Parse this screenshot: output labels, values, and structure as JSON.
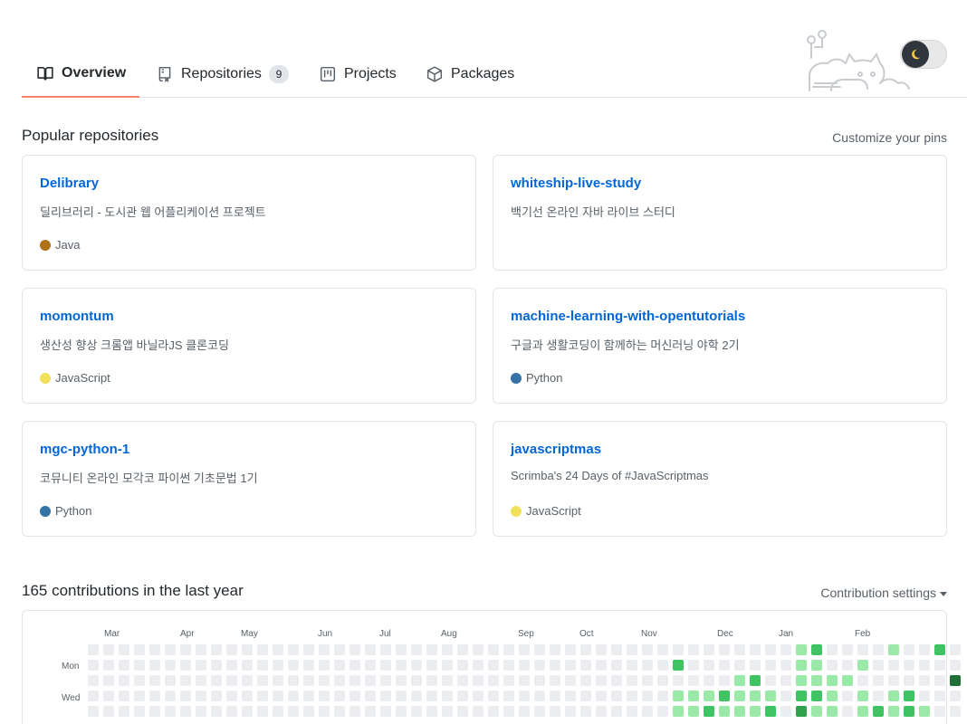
{
  "tabs": [
    {
      "label": "Overview",
      "icon": "book-icon",
      "active": true
    },
    {
      "label": "Repositories",
      "icon": "repo-icon",
      "count": "9"
    },
    {
      "label": "Projects",
      "icon": "project-icon"
    },
    {
      "label": "Packages",
      "icon": "package-icon"
    }
  ],
  "theme_toggle": {
    "icon": "moon-icon",
    "knob_color": "#2f363d"
  },
  "popular": {
    "title": "Popular repositories",
    "customize_link": "Customize your pins",
    "repos": [
      {
        "name": "Delibrary",
        "description": "딜리브러리 - 도시관 웹 어플리케이션 프로젝트",
        "language": "Java",
        "color": "#b07219"
      },
      {
        "name": "whiteship-live-study",
        "description": "백기선 온라인 자바 라이브 스터디",
        "language": "",
        "color": ""
      },
      {
        "name": "momontum",
        "description": "생산성 향상 크롬앱 바닐라JS 클론코딩",
        "language": "JavaScript",
        "color": "#f1e05a"
      },
      {
        "name": "machine-learning-with-opentutorials",
        "description": "구글과 생활코딩이 함께하는 머신러닝 야학 2기",
        "language": "Python",
        "color": "#3572A5"
      },
      {
        "name": "mgc-python-1",
        "description": "코뮤니티 온라인 모각코 파이썬 기초문법 1기",
        "language": "Python",
        "color": "#3572A5"
      },
      {
        "name": "javascriptmas",
        "description": "Scrimba's 24 Days of #JavaScriptmas",
        "language": "JavaScript",
        "color": "#f1e05a"
      }
    ]
  },
  "contributions": {
    "title": "165 contributions in the last year",
    "settings_label": "Contribution settings",
    "months": [
      "Mar",
      "Apr",
      "May",
      "Jun",
      "Jul",
      "Aug",
      "Sep",
      "Oct",
      "Nov",
      "Dec",
      "Jan",
      "Feb"
    ],
    "weekdays": [
      "Mon",
      "Wed"
    ],
    "level_colors": [
      "#ebedf0",
      "#9be9a8",
      "#40c463",
      "#30a14e",
      "#216e39"
    ],
    "weeks": [
      [
        0,
        0,
        0,
        0,
        0
      ],
      [
        0,
        0,
        0,
        0,
        0
      ],
      [
        0,
        0,
        0,
        0,
        0
      ],
      [
        0,
        0,
        0,
        0,
        0
      ],
      [
        0,
        0,
        0,
        0,
        0
      ],
      [
        0,
        0,
        0,
        0,
        0
      ],
      [
        0,
        0,
        0,
        0,
        0
      ],
      [
        0,
        0,
        0,
        0,
        0
      ],
      [
        0,
        0,
        0,
        0,
        0
      ],
      [
        0,
        0,
        0,
        0,
        0
      ],
      [
        0,
        0,
        0,
        0,
        0
      ],
      [
        0,
        0,
        0,
        0,
        0
      ],
      [
        0,
        0,
        0,
        0,
        0
      ],
      [
        0,
        0,
        0,
        0,
        0
      ],
      [
        0,
        0,
        0,
        0,
        0
      ],
      [
        0,
        0,
        0,
        0,
        0
      ],
      [
        0,
        0,
        0,
        0,
        0
      ],
      [
        0,
        0,
        0,
        0,
        0
      ],
      [
        0,
        0,
        0,
        0,
        0
      ],
      [
        0,
        0,
        0,
        0,
        0
      ],
      [
        0,
        0,
        0,
        0,
        0
      ],
      [
        0,
        0,
        0,
        0,
        0
      ],
      [
        0,
        0,
        0,
        0,
        0
      ],
      [
        0,
        0,
        0,
        0,
        0
      ],
      [
        0,
        0,
        0,
        0,
        0
      ],
      [
        0,
        0,
        0,
        0,
        0
      ],
      [
        0,
        0,
        0,
        0,
        0
      ],
      [
        0,
        0,
        0,
        0,
        0
      ],
      [
        0,
        0,
        0,
        0,
        0
      ],
      [
        0,
        0,
        0,
        0,
        0
      ],
      [
        0,
        0,
        0,
        0,
        0
      ],
      [
        0,
        0,
        0,
        0,
        0
      ],
      [
        0,
        0,
        0,
        0,
        0
      ],
      [
        0,
        0,
        0,
        0,
        0
      ],
      [
        0,
        0,
        0,
        0,
        0
      ],
      [
        0,
        0,
        0,
        0,
        0
      ],
      [
        0,
        0,
        0,
        0,
        0
      ],
      [
        0,
        0,
        0,
        0,
        0
      ],
      [
        0,
        2,
        0,
        1,
        1
      ],
      [
        0,
        0,
        0,
        1,
        1
      ],
      [
        0,
        0,
        0,
        1,
        2
      ],
      [
        0,
        0,
        0,
        2,
        1
      ],
      [
        0,
        0,
        1,
        1,
        1
      ],
      [
        0,
        0,
        2,
        1,
        1
      ],
      [
        0,
        0,
        0,
        1,
        2
      ],
      [
        0,
        0,
        0,
        0,
        0
      ],
      [
        1,
        1,
        1,
        2,
        3
      ],
      [
        2,
        1,
        1,
        2,
        1
      ],
      [
        0,
        0,
        1,
        1,
        1
      ],
      [
        0,
        0,
        1,
        0,
        0
      ],
      [
        0,
        1,
        0,
        1,
        1
      ],
      [
        0,
        0,
        0,
        0,
        2
      ],
      [
        1,
        0,
        0,
        1,
        1
      ],
      [
        0,
        0,
        0,
        2,
        2
      ],
      [
        0,
        0,
        0,
        0,
        1
      ],
      [
        2,
        0,
        0,
        0,
        0
      ],
      [
        0,
        0,
        4,
        0,
        0
      ]
    ]
  }
}
